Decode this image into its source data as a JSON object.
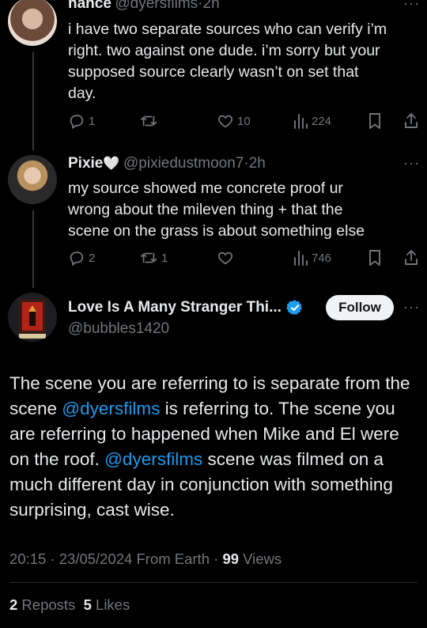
{
  "tweet1": {
    "name": "nance",
    "handle": "@dyersfilms",
    "time": "2h",
    "lines": [
      "i have two separate sources who can verify i’m",
      "right. two against one dude. i’m sorry but your",
      "supposed source clearly wasn’t on set that",
      "day."
    ],
    "replies": "1",
    "reposts": "",
    "likes": "10",
    "views": "224"
  },
  "tweet2": {
    "name": "Pixie",
    "name_emoji": "🤍",
    "handle": "@pixiedustmoon7",
    "time": "2h",
    "lines": [
      "my source showed me concrete proof ur",
      "wrong about the mileven thing + that the",
      "scene on the grass is about something else"
    ],
    "replies": "2",
    "reposts": "1",
    "likes": "",
    "views": "746"
  },
  "main": {
    "name": "Love Is A Many Stranger Thi...",
    "handle": "@bubbles1420",
    "follow_label": "Follow",
    "text": {
      "p1": "The scene you are referring to is separate from the scene ",
      "mention1": "@dyersfilms",
      "p2": " is referring to. The scene you are referring to happened when Mike and El were on the roof. ",
      "mention2": "@dyersfilms",
      "p3": " scene was filmed on a much different day in conjunction with something surprising, cast wise."
    },
    "timestamp": "20:15 · 23/05/2024 From Earth · ",
    "views_count": "99",
    "views_label": " Views",
    "reposts_count": "2",
    "reposts_label": " Reposts",
    "likes_count": "5",
    "likes_label": " Likes"
  },
  "colors": {
    "accent": "#1d9bf0",
    "muted": "#71767b",
    "verified": "#1d9bf0",
    "bg": "#000000"
  }
}
